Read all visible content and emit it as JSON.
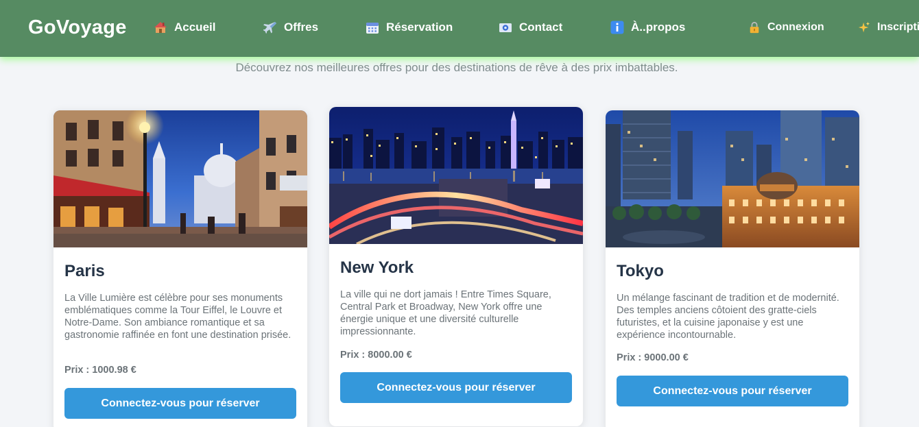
{
  "brand": "GoVoyage",
  "nav": [
    {
      "label": "Accueil",
      "icon": "house-icon"
    },
    {
      "label": "Offres",
      "icon": "airplane-icon"
    },
    {
      "label": "Réservation",
      "icon": "calendar-icon"
    },
    {
      "label": "Contact",
      "icon": "email-icon"
    },
    {
      "label": "À..propos",
      "icon": "info-icon"
    },
    {
      "label": "Connexion",
      "icon": "lock-icon"
    },
    {
      "label": "Inscription",
      "icon": "sparkles-icon"
    }
  ],
  "subtitle": "Découvrez nos meilleures offres pour des destinations de rêve à des prix imbattables.",
  "cards": [
    {
      "title": "Paris",
      "description": "La Ville Lumière est célèbre pour ses monuments emblématiques comme la Tour Eiffel, le Louvre et Notre-Dame. Son ambiance romantique et sa gastronomie raffinée en font une destination prisée.",
      "price": "Prix : 1000.98 €",
      "button": "Connectez-vous pour réserver"
    },
    {
      "title": "New York",
      "description": "La ville qui ne dort jamais ! Entre Times Square, Central Park et Broadway, New York offre une énergie unique et une diversité culturelle impressionnante.",
      "price": "Prix : 8000.00 €",
      "button": "Connectez-vous pour réserver"
    },
    {
      "title": "Tokyo",
      "description": "Un mélange fascinant de tradition et de modernité. Des temples anciens côtoient des gratte-ciels futuristes, et la cuisine japonaise y est une expérience incontournable.",
      "price": "Prix : 9000.00 €",
      "button": "Connectez-vous pour réserver"
    }
  ],
  "colors": {
    "navbar": "#568b62",
    "glow": "#6eff50",
    "button": "#3498db",
    "title": "#253447",
    "text": "#6b7378"
  }
}
